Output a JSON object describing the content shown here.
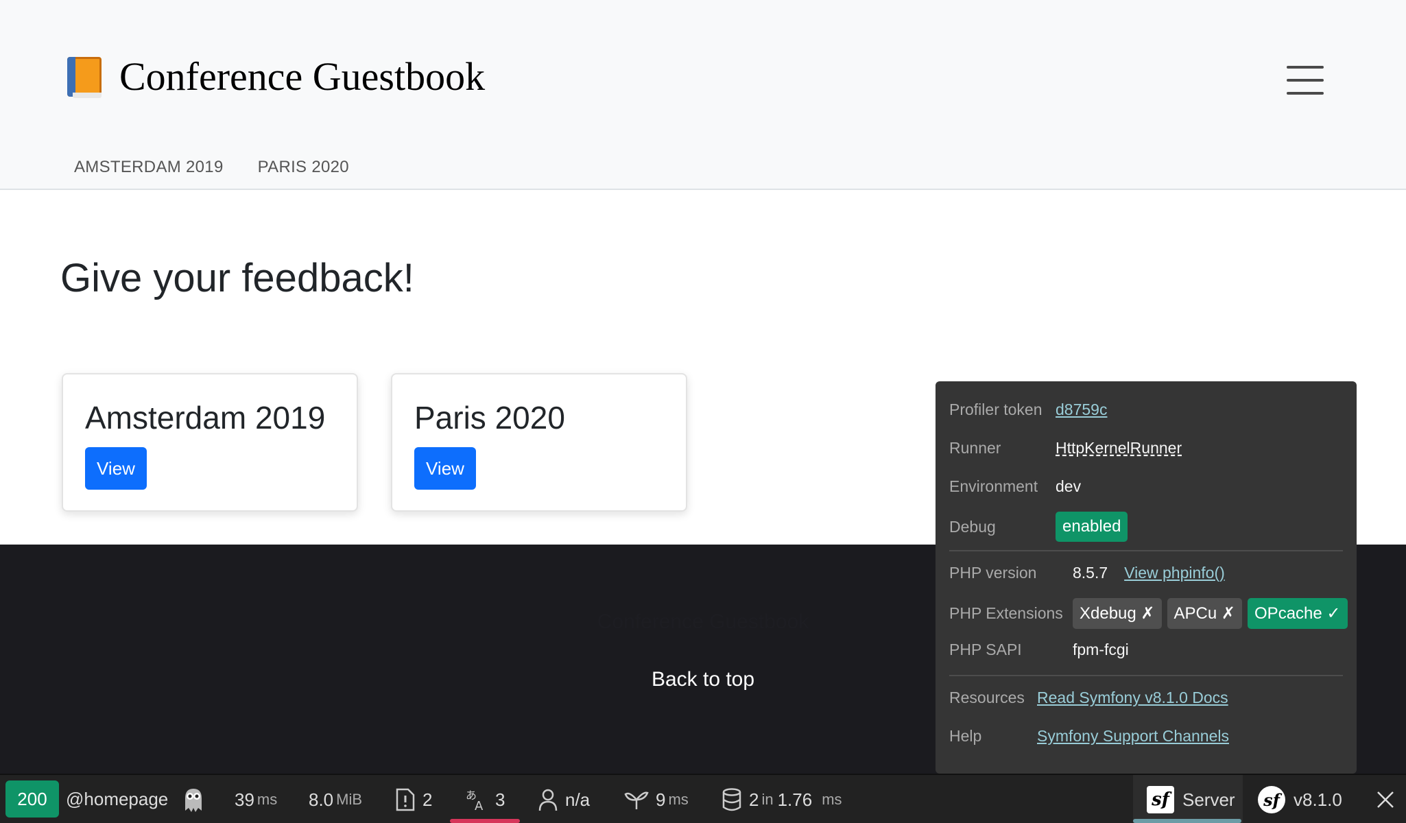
{
  "header": {
    "brand_icon": "orange-book-icon",
    "brand_title": "Conference Guestbook",
    "menu_icon": "hamburger-icon",
    "nav": [
      "AMSTERDAM 2019",
      "PARIS 2020"
    ]
  },
  "main": {
    "heading": "Give your feedback!",
    "cards": [
      {
        "title": "Amsterdam 2019",
        "button": "View"
      },
      {
        "title": "Paris 2020",
        "button": "View"
      }
    ]
  },
  "footer": {
    "brand": "Conference Guestbook",
    "back_to_top": "Back to top"
  },
  "profiler": {
    "token_label": "Profiler token",
    "token": "d8759c",
    "runner_label": "Runner",
    "runner": "HttpKernelRunner",
    "env_label": "Environment",
    "env": "dev",
    "debug_label": "Debug",
    "debug": "enabled",
    "php_version_label": "PHP version",
    "php_version": "8.5.7",
    "phpinfo_link": "View phpinfo()",
    "php_ext_label": "PHP Extensions",
    "ext_xdebug": "Xdebug ✗",
    "ext_apcu": "APCu ✗",
    "ext_opcache": "OPcache ✓",
    "php_sapi_label": "PHP SAPI",
    "php_sapi": "fpm-fcgi",
    "resources_label": "Resources",
    "resources_link": "Read Symfony v8.1.0 Docs",
    "help_label": "Help",
    "help_link": "Symfony Support Channels"
  },
  "toolbar": {
    "status": "200",
    "route": "@homepage",
    "ghost_icon": "ghost-icon",
    "time_value": "39",
    "time_unit": "ms",
    "memory_value": "8.0",
    "memory_unit": "MiB",
    "logs_icon": "log-file-icon",
    "logs_count": "2",
    "translation_icon": "translation-icon",
    "translation_count": "3",
    "user_icon": "user-icon",
    "user": "n/a",
    "twig_icon": "twig-leaf-icon",
    "twig_value": "9",
    "twig_unit": "ms",
    "db_icon": "database-icon",
    "db_queries": "2",
    "db_in": "in",
    "db_time": "1.76",
    "db_unit": "ms",
    "server_label": "Server",
    "version": "v8.1.0",
    "close_icon": "close-icon",
    "colors": {
      "status": "#0f9467",
      "translation_underline": "#d6365a",
      "server_underline": "#6c9ca6"
    }
  }
}
